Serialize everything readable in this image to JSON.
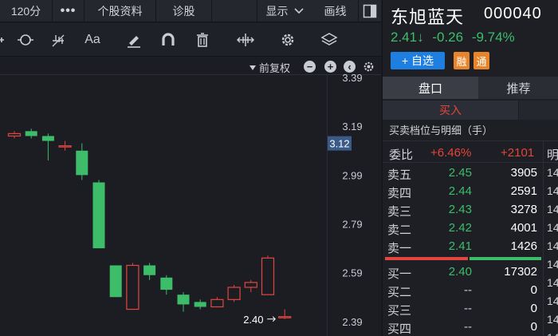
{
  "topbar": {
    "period": "120分",
    "more": "•••",
    "stock_info": "个股资料",
    "diagnose": "诊股",
    "display": "显示",
    "draw": "画线"
  },
  "toolbar": {
    "icons": [
      "range-select-icon",
      "cursor-crosshair-icon",
      "fork-icon",
      "text-icon",
      "pen-icon",
      "magnet-icon",
      "trash-icon",
      "move-icon",
      "settings-icon",
      "layers-icon"
    ],
    "text_tool": "Aa"
  },
  "chart": {
    "adjust_label": "前复权",
    "y_axis": {
      "ticks": [
        "3.39",
        "3.19",
        "2.99",
        "2.79",
        "2.59",
        "2.39"
      ],
      "current": "3.12"
    },
    "low_marker": "2.40",
    "colors": {
      "up": "#e2463e",
      "down": "#3dbd6a",
      "current_bg": "#3a5a88"
    }
  },
  "chart_data": {
    "type": "candlestick",
    "ylim": [
      2.36,
      3.4
    ],
    "candles": [
      {
        "o": 3.15,
        "c": 3.16,
        "h": 3.17,
        "l": 3.14,
        "dir": "up"
      },
      {
        "o": 3.17,
        "c": 3.15,
        "h": 3.18,
        "l": 3.14,
        "dir": "down"
      },
      {
        "o": 3.15,
        "c": 3.13,
        "h": 3.16,
        "l": 3.05,
        "dir": "down"
      },
      {
        "o": 3.11,
        "c": 3.11,
        "h": 3.13,
        "l": 3.09,
        "dir": "up"
      },
      {
        "o": 3.09,
        "c": 2.99,
        "h": 3.12,
        "l": 2.97,
        "dir": "down"
      },
      {
        "o": 2.96,
        "c": 2.69,
        "h": 2.97,
        "l": 2.69,
        "dir": "down"
      },
      {
        "o": 2.62,
        "c": 2.49,
        "h": 2.62,
        "l": 2.49,
        "dir": "down"
      },
      {
        "o": 2.44,
        "c": 2.62,
        "h": 2.63,
        "l": 2.44,
        "dir": "up"
      },
      {
        "o": 2.62,
        "c": 2.58,
        "h": 2.63,
        "l": 2.56,
        "dir": "down"
      },
      {
        "o": 2.57,
        "c": 2.52,
        "h": 2.58,
        "l": 2.5,
        "dir": "down"
      },
      {
        "o": 2.5,
        "c": 2.46,
        "h": 2.51,
        "l": 2.43,
        "dir": "down"
      },
      {
        "o": 2.47,
        "c": 2.45,
        "h": 2.48,
        "l": 2.44,
        "dir": "down"
      },
      {
        "o": 2.45,
        "c": 2.48,
        "h": 2.49,
        "l": 2.45,
        "dir": "up"
      },
      {
        "o": 2.48,
        "c": 2.53,
        "h": 2.54,
        "l": 2.47,
        "dir": "up"
      },
      {
        "o": 2.53,
        "c": 2.55,
        "h": 2.56,
        "l": 2.51,
        "dir": "up"
      },
      {
        "o": 2.5,
        "c": 2.65,
        "h": 2.66,
        "l": 2.5,
        "dir": "up"
      },
      {
        "o": 2.41,
        "c": 2.41,
        "h": 2.44,
        "l": 2.4,
        "dir": "up"
      }
    ]
  },
  "stock": {
    "name": "东旭蓝天",
    "code": "000040",
    "price": "2.41↓",
    "change": "-0.26",
    "change_pct": "-9.74%",
    "add_watch": "+ 自选",
    "badge_rong": "融",
    "badge_tong": "通"
  },
  "panel": {
    "tab_pankou": "盘口",
    "tab_tuijian": "推荐",
    "buy_tab": "买入",
    "depth_title": "买卖档位与明细（手）",
    "weibi_label": "委比",
    "weibi_pct": "+6.46%",
    "weibi_diff": "+2101",
    "detail_header": "明",
    "ratio_buy": 0.53
  },
  "order_book": {
    "asks": [
      {
        "label": "卖五",
        "price": "2.45",
        "vol": "3905"
      },
      {
        "label": "卖四",
        "price": "2.44",
        "vol": "2591"
      },
      {
        "label": "卖三",
        "price": "2.43",
        "vol": "3278"
      },
      {
        "label": "卖二",
        "price": "2.42",
        "vol": "4001"
      },
      {
        "label": "卖一",
        "price": "2.41",
        "vol": "1426"
      }
    ],
    "bids": [
      {
        "label": "买一",
        "price": "2.40",
        "vol": "17302"
      },
      {
        "label": "买二",
        "price": "--",
        "vol": "0"
      },
      {
        "label": "买三",
        "price": "--",
        "vol": "0"
      },
      {
        "label": "买四",
        "price": "--",
        "vol": "0"
      }
    ]
  },
  "detail_col": [
    "14",
    "14",
    "14",
    "14",
    "14",
    "14",
    "14",
    "14",
    "14",
    "14"
  ]
}
